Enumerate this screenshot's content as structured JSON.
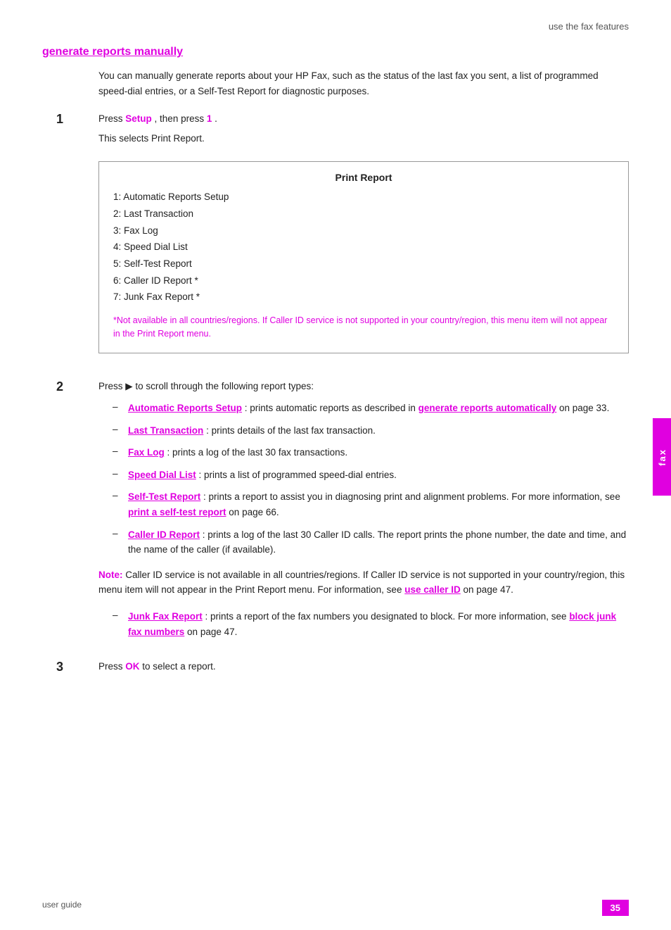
{
  "header": {
    "label": "use the fax features"
  },
  "section": {
    "title": "generate reports manually",
    "intro": "You can manually generate reports about your HP Fax, such as the status of the last fax you sent, a list of programmed speed-dial entries, or a Self-Test Report for diagnostic purposes."
  },
  "steps": [
    {
      "number": "1",
      "text_before": "Press ",
      "highlight1": "Setup",
      "text_mid": ", then press ",
      "highlight2": "1",
      "text_after": ".",
      "sub": "This selects Print Report.",
      "box": {
        "title": "Print Report",
        "items": [
          "1: Automatic Reports Setup",
          "2: Last Transaction",
          "3: Fax Log",
          "4: Speed Dial List",
          "5: Self-Test Report",
          "6: Caller ID Report *",
          "7: Junk Fax Report *"
        ],
        "note": "*Not available in all countries/regions. If Caller ID service is not supported in your country/region, this menu item will not appear in the Print Report menu."
      }
    },
    {
      "number": "2",
      "text": "Press ▶ to scroll through the following report types:",
      "bullets": [
        {
          "term": "Automatic Reports Setup",
          "separator": ": prints automatic reports as described in ",
          "link": "generate reports automatically",
          "link_suffix": " on page 33."
        },
        {
          "term": "Last Transaction",
          "separator": ": prints details of the last fax transaction.",
          "link": "",
          "link_suffix": ""
        },
        {
          "term": "Fax Log",
          "separator": ": prints a log of the last 30 fax transactions.",
          "link": "",
          "link_suffix": ""
        },
        {
          "term": "Speed Dial List",
          "separator": ": prints a list of programmed speed-dial entries.",
          "link": "",
          "link_suffix": ""
        },
        {
          "term": "Self-Test Report",
          "separator": ": prints a report to assist you in diagnosing print and alignment problems. For more information, see ",
          "link": "print a self-test report",
          "link_suffix": " on page 66."
        },
        {
          "term": "Caller ID Report",
          "separator": ": prints a log of the last 30 Caller ID calls. The report prints the phone number, the date and time, and the name of the caller (if available).",
          "link": "",
          "link_suffix": ""
        }
      ],
      "note": {
        "label": "Note: ",
        "text": "Caller ID service is not available in all countries/regions. If Caller ID service is not supported in your country/region, this menu item will not appear in the Print Report menu. For information, see ",
        "link": "use caller ID",
        "link_suffix": " on page 47."
      },
      "extra_bullets": [
        {
          "term": "Junk Fax Report",
          "separator": ": prints a report of the fax numbers you designated to block. For more information, see ",
          "link": "block junk fax numbers",
          "link_suffix": " on page 47."
        }
      ]
    },
    {
      "number": "3",
      "text_before": "Press ",
      "highlight1": "OK",
      "text_after": " to select a report."
    }
  ],
  "side_tab": {
    "label": "fax"
  },
  "footer": {
    "left": "user guide",
    "right": "35"
  }
}
